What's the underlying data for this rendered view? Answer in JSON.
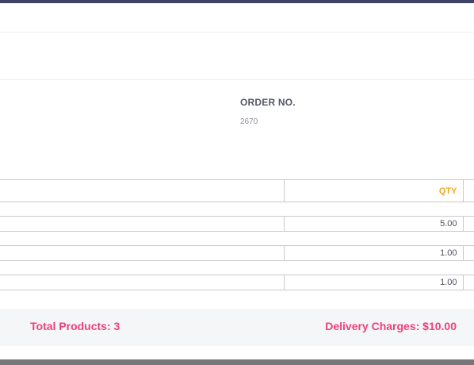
{
  "order": {
    "label": "ORDER NO.",
    "number": "2670"
  },
  "items_table": {
    "qty_header": "QTY",
    "rows": [
      {
        "qty": "5.00"
      },
      {
        "qty": "1.00"
      },
      {
        "qty": "1.00"
      }
    ]
  },
  "summary": {
    "total_products": "Total Products: 3",
    "delivery_charges": "Delivery Charges: $10.00"
  },
  "colors": {
    "top_bar": "#3f4368",
    "accent_pink": "#ef3f7b",
    "qty_header": "#f5a623",
    "footer_bg": "#f5f6f8",
    "bottom_bar": "#77777b"
  }
}
